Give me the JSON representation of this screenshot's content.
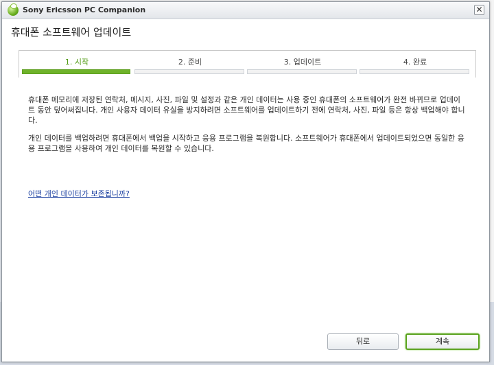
{
  "window": {
    "title": "Sony Ericsson PC Companion",
    "close_glyph": "✕"
  },
  "heading": "휴대폰 소프트웨어 업데이트",
  "steps": [
    {
      "label": "1. 시작",
      "state": "active"
    },
    {
      "label": "2. 준비",
      "state": "inactive"
    },
    {
      "label": "3. 업데이트",
      "state": "inactive"
    },
    {
      "label": "4. 완료",
      "state": "inactive"
    }
  ],
  "content": {
    "paragraph1": "휴대폰 메모리에 저장된 연락처, 메시지, 사진, 파일 및 설정과 같은 개인 데이터는 사용 중인 휴대폰의 소프트웨어가 완전 바뀌므로 업데이트 동안 덮어써집니다. 개인 사용자 데이터 유실을 방지하려면 소프트웨어를 업데이트하기 전에 연락처, 사진, 파일 등은 항상 백업해야 합니다.",
    "paragraph2": "개인 데이터를 백업하려면 휴대폰에서 백업을 시작하고 응용 프로그램을 복원합니다. 소프트웨어가 휴대폰에서 업데이트되었으면 동일한 응용 프로그램을 사용하여 개인 데이터를 복원할 수 있습니다.",
    "link": "어떤 개인 데이터가 보존됩니까?"
  },
  "buttons": {
    "back": "뒤로",
    "continue": "계속"
  },
  "colors": {
    "accent": "#6fb32a",
    "link": "#1a3fa0"
  }
}
